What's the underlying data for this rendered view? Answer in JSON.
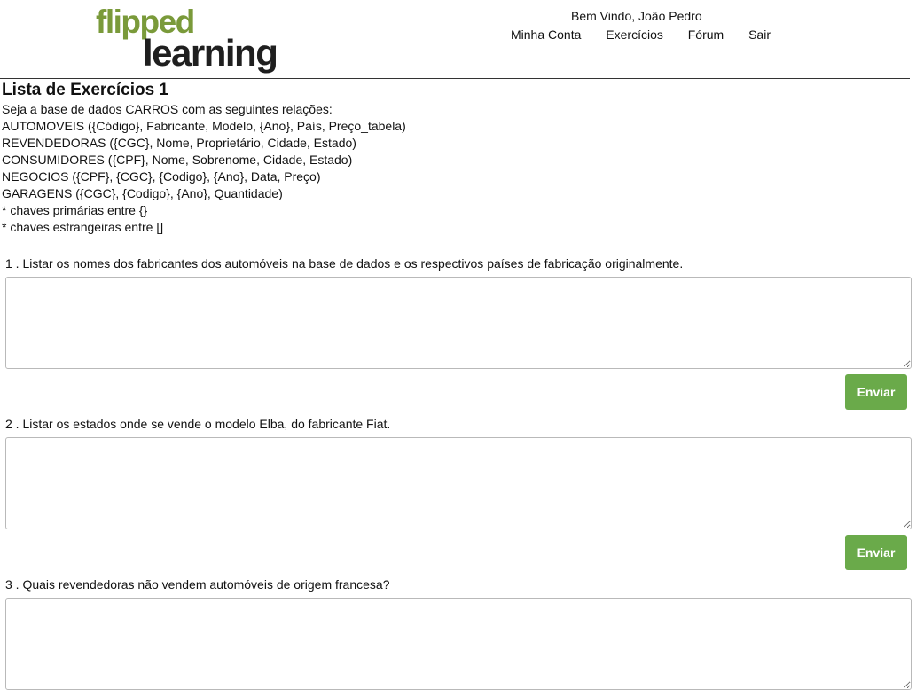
{
  "logo": {
    "line1": "flipped",
    "line2": "learning"
  },
  "header": {
    "welcome": "Bem Vindo, João Pedro",
    "nav": [
      "Minha Conta",
      "Exercícios",
      "Fórum",
      "Sair"
    ]
  },
  "page": {
    "title": "Lista de Exercícios 1",
    "description": [
      "Seja a base de dados CARROS com as seguintes relações:",
      "AUTOMOVEIS ({Código}, Fabricante, Modelo, {Ano}, País, Preço_tabela)",
      "REVENDEDORAS ({CGC}, Nome, Proprietário, Cidade, Estado)",
      "CONSUMIDORES ({CPF}, Nome, Sobrenome, Cidade, Estado)",
      "NEGOCIOS ({CPF}, {CGC}, {Codigo}, {Ano}, Data, Preço)",
      "GARAGENS ({CGC}, {Codigo}, {Ano}, Quantidade)",
      "* chaves primárias entre {}",
      "* chaves estrangeiras entre []"
    ]
  },
  "questions": [
    {
      "text": "1 . Listar os nomes dos fabricantes dos automóveis na base de dados e os respectivos países de fabricação originalmente.",
      "answer": "",
      "button": "Enviar"
    },
    {
      "text": "2 . Listar os estados onde se vende o modelo Elba, do fabricante Fiat.",
      "answer": "",
      "button": "Enviar"
    },
    {
      "text": "3 . Quais revendedoras não vendem automóveis de origem francesa?",
      "answer": ""
    }
  ]
}
